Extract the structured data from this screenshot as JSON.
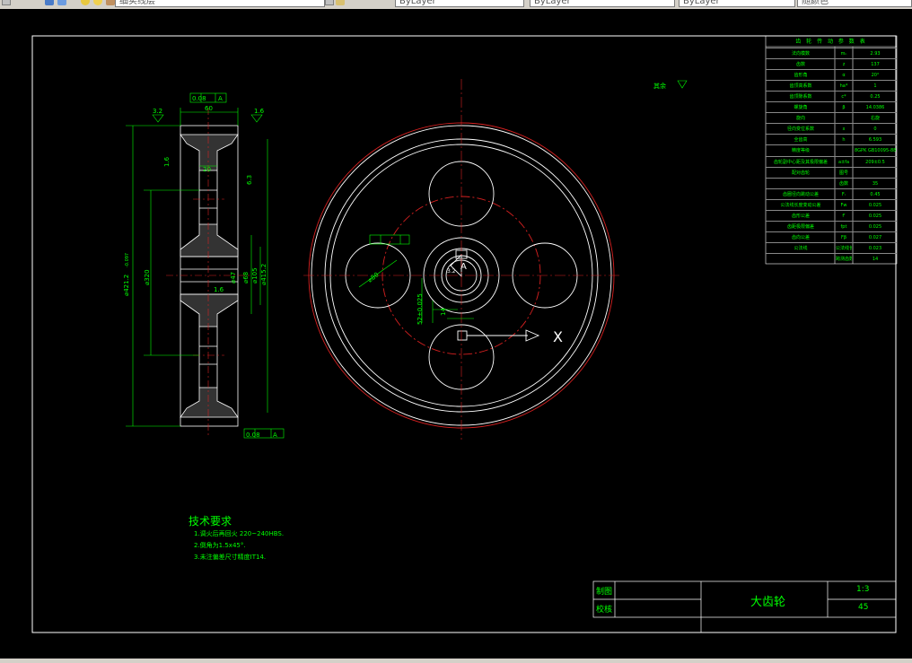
{
  "toolbar": {
    "combo_style": "细实线层",
    "combo_color": "ByLayer",
    "combo_linetype": "ByLayer",
    "combo_lineweight": "ByLayer",
    "combo_plot": "随颜色"
  },
  "drawing": {
    "roughness_note": "其余",
    "side_view": {
      "tol_flatness_top": "0.08",
      "tol_flatness_bottom": "0.08",
      "tol_ref": "A",
      "dim_width": "60",
      "dim_hub": "20",
      "dim_left_chamfer": "3.2",
      "dim_right_chamfer": "1.6",
      "dim_rim": "1.6",
      "dim_rim2": "6.3",
      "dim_outer": "⌀421.2",
      "dim_tol": "-0.097",
      "dim_root": "⌀320",
      "dim_bore": "⌀105",
      "dim_hub_d": "⌀68",
      "dim_pitch": "⌀415.2",
      "dim_bore2": "⌀47",
      "dim_small": "1.6"
    },
    "front_view": {
      "dim_hole": "⌀80",
      "dim_keyway": "52±0.025",
      "dim_key_h": "14",
      "dim_rough": "3.2",
      "label_x": "X",
      "label_a": "A"
    }
  },
  "param_table": {
    "title": "齿 轮 传 动 参 数 表",
    "rows": [
      {
        "name": "法向模数",
        "sym": "mₙ",
        "val": "2.93"
      },
      {
        "name": "齿数",
        "sym": "z",
        "val": "137"
      },
      {
        "name": "齿形角",
        "sym": "α",
        "val": "20°"
      },
      {
        "name": "齿顶高系数",
        "sym": "ha*",
        "val": "1"
      },
      {
        "name": "齿顶隙系数",
        "sym": "c*",
        "val": "0.25"
      },
      {
        "name": "螺旋角",
        "sym": "β",
        "val": "14.0386"
      },
      {
        "name": "旋向",
        "sym": "",
        "val": "右旋"
      },
      {
        "name": "径向变位系数",
        "sym": "x",
        "val": "0"
      },
      {
        "name": "全齿高",
        "sym": "h",
        "val": "6.593"
      },
      {
        "name": "精度等级",
        "sym": "",
        "val": "8GPK GB10095-88"
      },
      {
        "name": "齿轮副中心距及其极限偏差",
        "sym": "a±fa",
        "val": "209±0.5"
      },
      {
        "name": "配对齿轮",
        "sym": "图号",
        "val": ""
      },
      {
        "name": "",
        "sym": "齿数",
        "val": "35"
      },
      {
        "name": "齿圈径向跳动公差",
        "sym": "Fᵣ",
        "val": "0.45"
      },
      {
        "name": "公法线长度变动公差",
        "sym": "Fw",
        "val": "0.025"
      },
      {
        "name": "齿形公差",
        "sym": "fᶠ",
        "val": "0.025"
      },
      {
        "name": "齿距极限偏差",
        "sym": "fpt",
        "val": "0.025"
      },
      {
        "name": "齿向公差",
        "sym": "Fβ",
        "val": "0.027"
      },
      {
        "name": "公法线",
        "sym": "公法线长度",
        "val": "0.023"
      },
      {
        "name": "",
        "sym": "跨测齿数",
        "val": "14"
      }
    ]
  },
  "tech_req": {
    "title": "技术要求",
    "items": [
      "1.调火后再回火 220~240HBS.",
      "2.倒角为1.5x45°.",
      "3.未注偏差尺寸精度IT14."
    ]
  },
  "title_block": {
    "drawn_label": "制图",
    "checked_label": "校核",
    "part_name": "大齿轮",
    "scale": "1:3",
    "material": "45"
  }
}
